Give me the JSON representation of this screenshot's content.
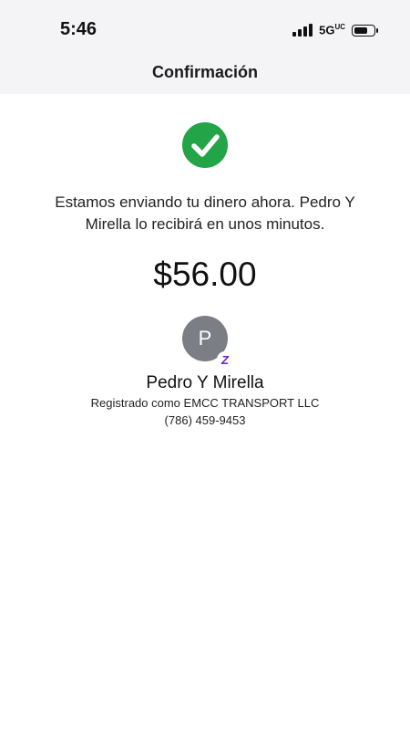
{
  "status_bar": {
    "time": "5:46",
    "network": "5G",
    "network_suffix": "UC",
    "signal_bars": 4,
    "battery_level": 0.65
  },
  "header": {
    "title": "Confirmación"
  },
  "confirmation": {
    "icon": "checkmark-circle-icon",
    "icon_color": "#22a447",
    "message": "Estamos enviando tu dinero ahora. Pedro Y Mirella lo recibirá en unos minutos.",
    "amount": "$56.00"
  },
  "recipient": {
    "avatar_initial": "P",
    "badge_icon": "zelle-icon",
    "badge_letter": "Z",
    "badge_color": "#6d1ed4",
    "name": "Pedro Y Mirella",
    "registered_as": "Registrado como EMCC TRANSPORT LLC",
    "phone": "(786) 459-9453"
  }
}
